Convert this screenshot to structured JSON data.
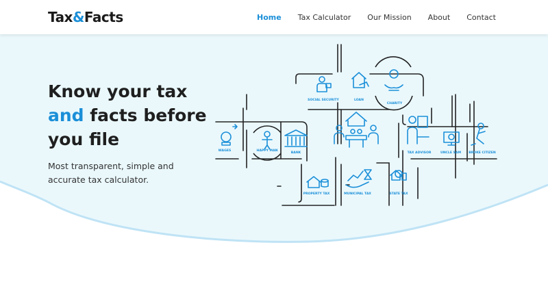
{
  "brand": {
    "part1": "Tax",
    "amp": "&",
    "part2": "Facts"
  },
  "nav": {
    "home": "Home",
    "tax_calculator": "Tax Calculator",
    "our_mission": "Our Mission",
    "about": "About",
    "contact": "Contact"
  },
  "hero": {
    "title_line1": "Know your tax",
    "title_highlight": "and",
    "title_rest": " facts before",
    "title_line3": "you file",
    "subtitle_line1": "Most transparent, simple and",
    "subtitle_line2": "accurate tax calculator."
  },
  "illustration": {
    "labels": {
      "social_security": "SOCIAL SECURITY",
      "loan": "LOAN",
      "charity": "CHARITY",
      "wages": "WAGES",
      "happy_man": "HAPPY MAN",
      "bank": "BANK",
      "tax_advisor": "TAX ADVISOR",
      "uncle_sam": "UNCLE SAM",
      "broke_citizen": "BROKE CITIZEN",
      "property_tax": "PROPERTY TAX",
      "municipal_tax": "MUNICIPAL TAX",
      "state_tax": "STATE TAX"
    }
  },
  "colors": {
    "accent": "#1b8fd8",
    "hero_background": "#eaf8fc",
    "wave": "#bfe3f5",
    "text_dark": "#1f1f1f"
  }
}
